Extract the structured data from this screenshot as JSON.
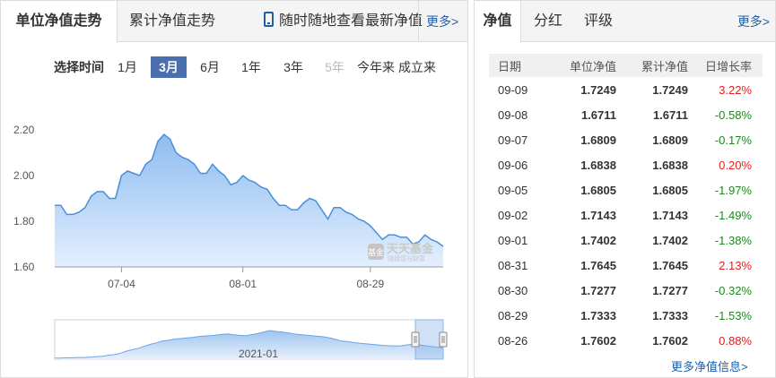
{
  "left_panel": {
    "tabs": {
      "unit_nav_trend": "单位净值走势",
      "cumulative_nav_trend": "累计净值走势",
      "mobile_promo": "随时随地查看最新净值",
      "more": "更多>"
    },
    "period_selector": {
      "label": "选择时间",
      "options": [
        "1月",
        "3月",
        "6月",
        "1年",
        "3年",
        "5年",
        "今年来",
        "成立来"
      ],
      "selected": "3月",
      "disabled": [
        "5年"
      ]
    },
    "watermark": {
      "brand": "天天基金",
      "slogan": "随接您与财富",
      "logo_text": "基金"
    },
    "colors": {
      "area_fill": "#a9cdf4",
      "line": "#4a8fdb",
      "navigator_fill": "#bcd6f5",
      "navigator_handle": "#9ec4ee"
    }
  },
  "chart_data": {
    "type": "area",
    "title": "",
    "ylabel": "",
    "xlabel": "",
    "ylim": [
      1.6,
      2.2
    ],
    "yticks": [
      "2.20",
      "2.00",
      "1.80",
      "1.60"
    ],
    "xticks": [
      "07-04",
      "08-01",
      "08-29"
    ],
    "grid": false,
    "series": [
      {
        "values": [
          1.87,
          1.87,
          1.83,
          1.83,
          1.84,
          1.86,
          1.91,
          1.93,
          1.93,
          1.9,
          1.9,
          2.0,
          2.02,
          2.01,
          2.0,
          2.05,
          2.07,
          2.15,
          2.18,
          2.16,
          2.1,
          2.08,
          2.07,
          2.05,
          2.01,
          2.01,
          2.05,
          2.02,
          2.0,
          1.96,
          1.97,
          2.0,
          1.98,
          1.97,
          1.95,
          1.94,
          1.9,
          1.87,
          1.87,
          1.85,
          1.85,
          1.88,
          1.9,
          1.89,
          1.85,
          1.81,
          1.86,
          1.86,
          1.84,
          1.83,
          1.81,
          1.8,
          1.78,
          1.75,
          1.72,
          1.74,
          1.74,
          1.73,
          1.73,
          1.7,
          1.71,
          1.74,
          1.72,
          1.71,
          1.69
        ]
      }
    ],
    "navigator": {
      "date_label": "2021-01",
      "values": [
        0.04,
        0.04,
        0.05,
        0.05,
        0.06,
        0.06,
        0.07,
        0.09,
        0.1,
        0.14,
        0.16,
        0.21,
        0.28,
        0.33,
        0.38,
        0.45,
        0.52,
        0.57,
        0.63,
        0.66,
        0.7,
        0.72,
        0.74,
        0.76,
        0.79,
        0.81,
        0.82,
        0.84,
        0.87,
        0.88,
        0.85,
        0.83,
        0.82,
        0.86,
        0.9,
        0.95,
        1.0,
        0.97,
        0.95,
        0.92,
        0.88,
        0.86,
        0.84,
        0.82,
        0.8,
        0.78,
        0.74,
        0.69,
        0.63,
        0.62,
        0.58,
        0.56,
        0.54,
        0.52,
        0.5,
        0.48,
        0.47,
        0.46,
        0.47,
        0.5,
        0.52,
        0.5,
        0.47,
        0.44,
        0.42,
        0.4
      ]
    }
  },
  "right_panel": {
    "tabs": {
      "nav": "净值",
      "dividend": "分红",
      "rating": "评级",
      "more": "更多>"
    },
    "table": {
      "headers": [
        "日期",
        "单位净值",
        "累计净值",
        "日增长率"
      ],
      "rows": [
        {
          "date": "09-09",
          "unit_nav": "1.7249",
          "cum_nav": "1.7249",
          "growth": "3.22%",
          "dir": "up"
        },
        {
          "date": "09-08",
          "unit_nav": "1.6711",
          "cum_nav": "1.6711",
          "growth": "-0.58%",
          "dir": "down"
        },
        {
          "date": "09-07",
          "unit_nav": "1.6809",
          "cum_nav": "1.6809",
          "growth": "-0.17%",
          "dir": "down"
        },
        {
          "date": "09-06",
          "unit_nav": "1.6838",
          "cum_nav": "1.6838",
          "growth": "0.20%",
          "dir": "up"
        },
        {
          "date": "09-05",
          "unit_nav": "1.6805",
          "cum_nav": "1.6805",
          "growth": "-1.97%",
          "dir": "down"
        },
        {
          "date": "09-02",
          "unit_nav": "1.7143",
          "cum_nav": "1.7143",
          "growth": "-1.49%",
          "dir": "down"
        },
        {
          "date": "09-01",
          "unit_nav": "1.7402",
          "cum_nav": "1.7402",
          "growth": "-1.38%",
          "dir": "down"
        },
        {
          "date": "08-31",
          "unit_nav": "1.7645",
          "cum_nav": "1.7645",
          "growth": "2.13%",
          "dir": "up"
        },
        {
          "date": "08-30",
          "unit_nav": "1.7277",
          "cum_nav": "1.7277",
          "growth": "-0.32%",
          "dir": "down"
        },
        {
          "date": "08-29",
          "unit_nav": "1.7333",
          "cum_nav": "1.7333",
          "growth": "-1.53%",
          "dir": "down"
        },
        {
          "date": "08-26",
          "unit_nav": "1.7602",
          "cum_nav": "1.7602",
          "growth": "0.88%",
          "dir": "up"
        }
      ]
    },
    "more_nav_info": "更多净值信息>"
  }
}
